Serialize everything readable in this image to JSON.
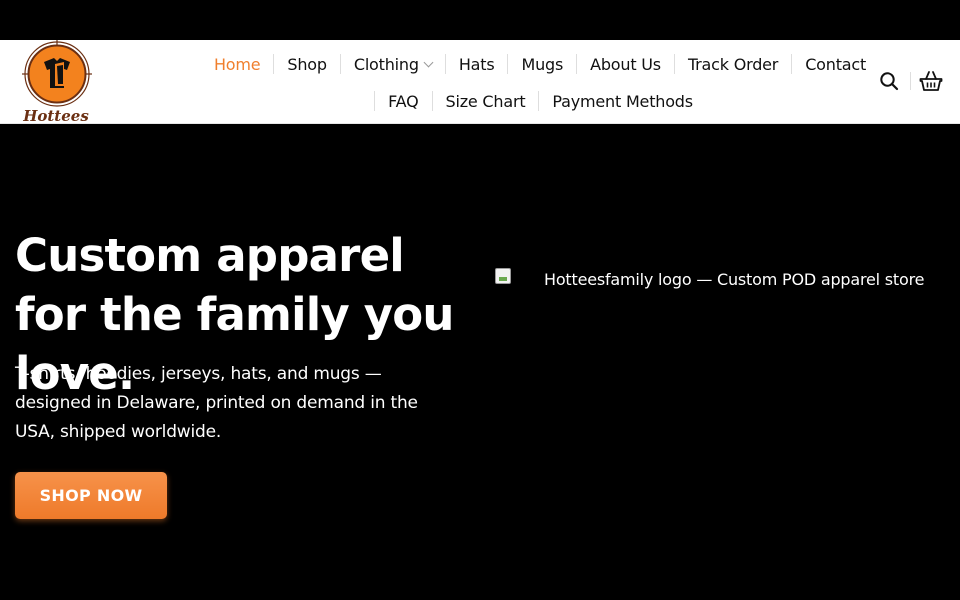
{
  "brand": {
    "logo_text": "Hottees",
    "colors": {
      "accent": "#f07f2d",
      "logo_brown": "#6b2f12",
      "logo_orange": "#f3821e"
    }
  },
  "nav": {
    "row1": [
      {
        "label": "Home",
        "active": true
      },
      {
        "label": "Shop"
      },
      {
        "label": "Clothing",
        "has_dropdown": true
      },
      {
        "label": "Hats"
      },
      {
        "label": "Mugs"
      },
      {
        "label": "About Us"
      },
      {
        "label": "Track Order"
      },
      {
        "label": "Contact"
      }
    ],
    "row2": [
      {
        "label": "FAQ"
      },
      {
        "label": "Size Chart"
      },
      {
        "label": "Payment Methods"
      }
    ]
  },
  "header_icons": [
    "search-icon",
    "basket-icon"
  ],
  "hero": {
    "title": "Custom apparel for the family you love.",
    "subtitle": "T-shirts, hoodies, jerseys, hats, and mugs — designed in Delaware, printed on demand in the USA, shipped worldwide.",
    "cta_label": "SHOP NOW",
    "image_alt": "Hotteesfamily logo — Custom POD apparel store"
  }
}
